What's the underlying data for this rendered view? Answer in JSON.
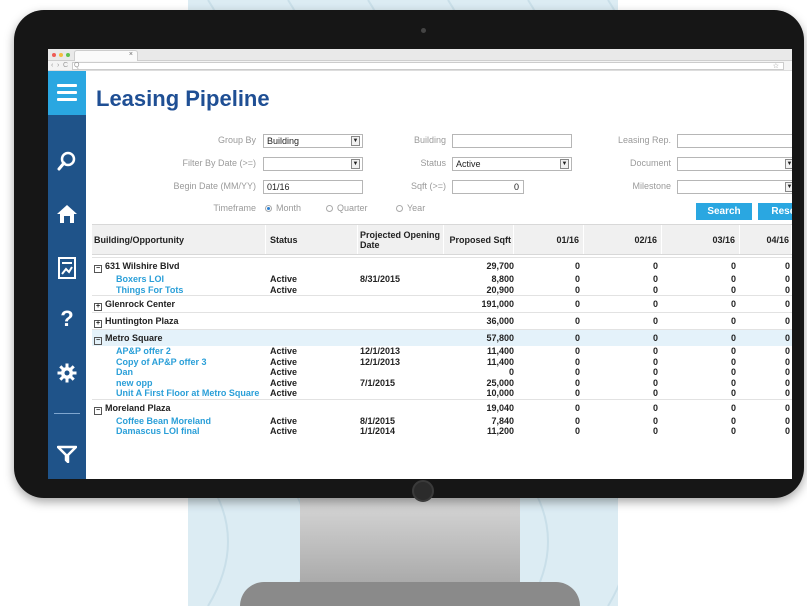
{
  "browser": {
    "tab_close": "×",
    "back": "‹",
    "forward": "›",
    "reload": "C",
    "address_icon": "Q",
    "bookmark": "☆"
  },
  "sidebar": {
    "accent": "#2aa7e1",
    "background": "#1f5389",
    "items": [
      {
        "icon": "search-icon",
        "glyph": "⚲"
      },
      {
        "icon": "home-icon"
      },
      {
        "icon": "report-chart-icon"
      },
      {
        "icon": "help-icon",
        "glyph": "?"
      },
      {
        "icon": "settings-gear-icon",
        "glyph": "✱"
      },
      {
        "icon": "filter-funnel-icon",
        "glyph": "⊽"
      }
    ]
  },
  "page": {
    "title": "Leasing Pipeline"
  },
  "filters": {
    "group_by": {
      "label": "Group By",
      "value": "Building"
    },
    "filter_by_date": {
      "label": "Filter By Date (>=)",
      "value": ""
    },
    "begin_date": {
      "label": "Begin Date (MM/YY)",
      "value": "01/16"
    },
    "timeframe": {
      "label": "Timeframe",
      "options": [
        "Month",
        "Quarter",
        "Year"
      ],
      "selected": "Month"
    },
    "building": {
      "label": "Building",
      "value": ""
    },
    "status": {
      "label": "Status",
      "value": "Active"
    },
    "sqft": {
      "label": "Sqft (>=)",
      "value": "0"
    },
    "leasing_rep": {
      "label": "Leasing Rep.",
      "value": ""
    },
    "document": {
      "label": "Document",
      "value": ""
    },
    "milestone": {
      "label": "Milestone",
      "value": ""
    },
    "search_label": "Search",
    "reset_label": "Reset",
    "dropdown_arrow": "▼"
  },
  "table": {
    "headers": [
      "Building/Opportunity",
      "Status",
      "Projected Opening Date",
      "Proposed Sqft",
      "01/16",
      "02/16",
      "03/16",
      "04/16"
    ],
    "rows": [
      {
        "type": "group",
        "expander": "−",
        "name": "631 Wilshire Blvd",
        "status": "",
        "date": "",
        "sqft": "29,700",
        "m1": "0",
        "m2": "0",
        "m3": "0",
        "m4": "0"
      },
      {
        "type": "item",
        "name": "Boxers LOI",
        "status": "Active",
        "date": "8/31/2015",
        "sqft": "8,800",
        "m1": "0",
        "m2": "0",
        "m3": "0",
        "m4": "0"
      },
      {
        "type": "item",
        "name": "Things For Tots",
        "status": "Active",
        "date": "",
        "sqft": "20,900",
        "m1": "0",
        "m2": "0",
        "m3": "0",
        "m4": "0"
      },
      {
        "type": "group",
        "expander": "+",
        "name": "Glenrock Center",
        "status": "",
        "date": "",
        "sqft": "191,000",
        "m1": "0",
        "m2": "0",
        "m3": "0",
        "m4": "0"
      },
      {
        "type": "group",
        "expander": "+",
        "name": "Huntington Plaza",
        "status": "",
        "date": "",
        "sqft": "36,000",
        "m1": "0",
        "m2": "0",
        "m3": "0",
        "m4": "0"
      },
      {
        "type": "group",
        "expander": "−",
        "name": "Metro Square",
        "status": "",
        "date": "",
        "sqft": "57,800",
        "m1": "0",
        "m2": "0",
        "m3": "0",
        "m4": "0",
        "highlight": true
      },
      {
        "type": "item",
        "name": "AP&P offer 2",
        "status": "Active",
        "date": "12/1/2013",
        "sqft": "11,400",
        "m1": "0",
        "m2": "0",
        "m3": "0",
        "m4": "0"
      },
      {
        "type": "item",
        "name": "Copy of AP&P offer 3",
        "status": "Active",
        "date": "12/1/2013",
        "sqft": "11,400",
        "m1": "0",
        "m2": "0",
        "m3": "0",
        "m4": "0"
      },
      {
        "type": "item",
        "name": "Dan",
        "status": "Active",
        "date": "",
        "sqft": "0",
        "m1": "0",
        "m2": "0",
        "m3": "0",
        "m4": "0"
      },
      {
        "type": "item",
        "name": "new opp",
        "status": "Active",
        "date": "7/1/2015",
        "sqft": "25,000",
        "m1": "0",
        "m2": "0",
        "m3": "0",
        "m4": "0"
      },
      {
        "type": "item",
        "name": "Unit A First Floor at Metro Square",
        "status": "Active",
        "date": "",
        "sqft": "10,000",
        "m1": "0",
        "m2": "0",
        "m3": "0",
        "m4": "0"
      },
      {
        "type": "group",
        "expander": "−",
        "name": "Moreland Plaza",
        "status": "",
        "date": "",
        "sqft": "19,040",
        "m1": "0",
        "m2": "0",
        "m3": "0",
        "m4": "0"
      },
      {
        "type": "item",
        "name": "Coffee Bean Moreland",
        "status": "Active",
        "date": "8/1/2015",
        "sqft": "7,840",
        "m1": "0",
        "m2": "0",
        "m3": "0",
        "m4": "0"
      },
      {
        "type": "item",
        "name": "Damascus LOI final",
        "status": "Active",
        "date": "1/1/2014",
        "sqft": "11,200",
        "m1": "0",
        "m2": "0",
        "m3": "0",
        "m4": "0"
      }
    ]
  }
}
